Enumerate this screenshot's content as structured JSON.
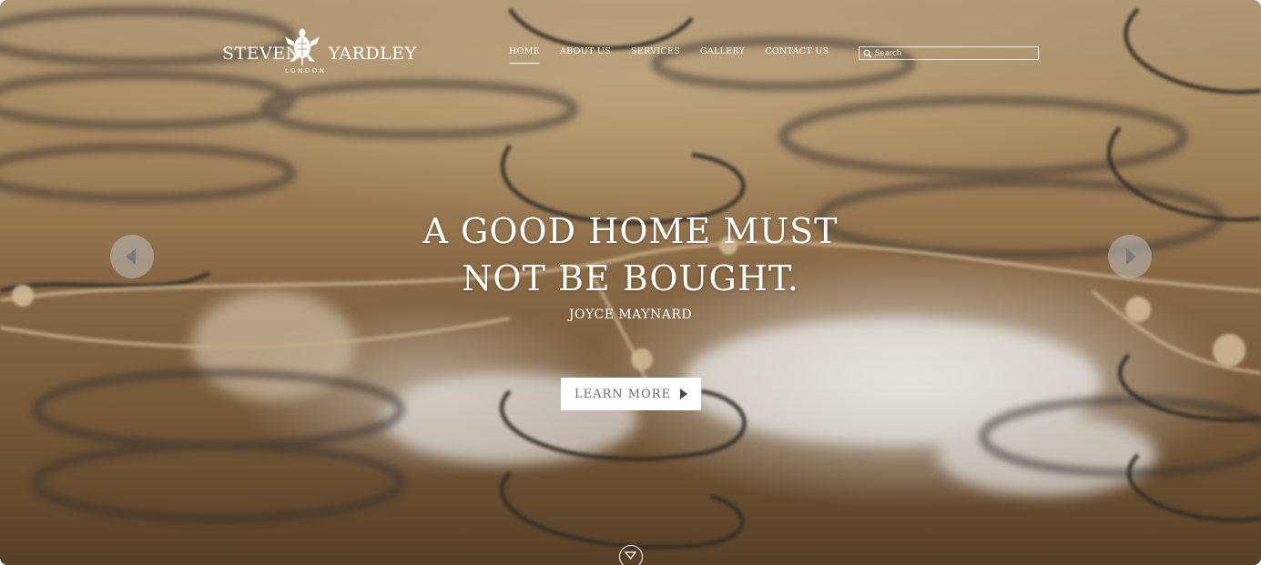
{
  "brand": {
    "name_first": "STEVEN",
    "name_second": "YARDLEY",
    "location": "LONDON",
    "logo_icon": "turtle-icon"
  },
  "nav": {
    "items": [
      {
        "label": "HOME",
        "active": true
      },
      {
        "label": "ABOUT US",
        "active": false
      },
      {
        "label": "SERVICES",
        "active": false
      },
      {
        "label": "GALLERY",
        "active": false
      },
      {
        "label": "CONTACT US",
        "active": false
      }
    ]
  },
  "search": {
    "placeholder": "Search",
    "icon": "search-icon"
  },
  "hero": {
    "headline_line1": "A GOOD HOME MUST",
    "headline_line2": "NOT BE BOUGHT.",
    "author": "JOYCE MAYNARD",
    "cta_label": "LEARN MORE",
    "cta_icon": "play-triangle-icon",
    "prev_icon": "arrow-left-icon",
    "next_icon": "arrow-right-icon",
    "scroll_icon": "chevron-down-icon"
  },
  "colors": {
    "text": "#ffffff",
    "button_bg": "#ffffff",
    "button_text": "#6d6d6d",
    "arrow_bg": "#bebebe"
  }
}
